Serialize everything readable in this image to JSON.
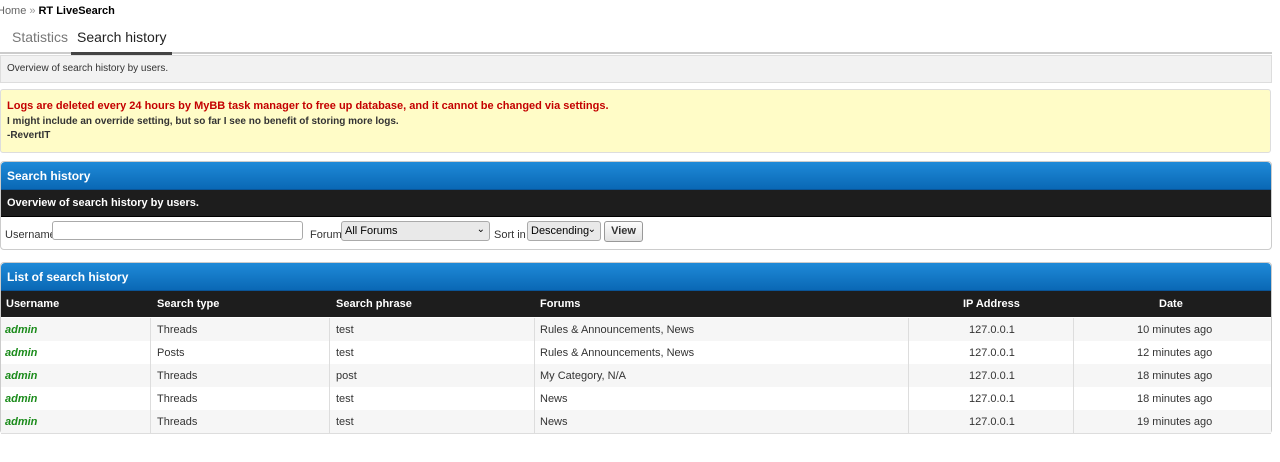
{
  "breadcrumb": {
    "home": "Home",
    "separator": "»",
    "current": "RT LiveSearch"
  },
  "tabs": [
    {
      "label": "Statistics"
    },
    {
      "label": "Search history"
    }
  ],
  "page_description": "Overview of search history by users.",
  "notice": {
    "warning": "Logs are deleted every 24 hours by MyBB task manager to free up database, and it cannot be changed via settings.",
    "line2": "I might include an override setting, but so far I see no benefit of storing more logs.",
    "signature": "-RevertIT"
  },
  "filter_box": {
    "title": "Search history",
    "subtitle": "Overview of search history by users.",
    "username_label": "Username",
    "username_value": "",
    "forum_label": "Forum",
    "forum_selected": "All Forums",
    "sort_label": "Sort in",
    "sort_selected": "Descending",
    "view_button": "View"
  },
  "history": {
    "title": "List of search history",
    "columns": [
      "Username",
      "Search type",
      "Search phrase",
      "Forums",
      "IP Address",
      "Date"
    ],
    "rows": [
      {
        "username": "admin",
        "type": "Threads",
        "phrase": "test",
        "forums": [
          "Rules & Announcements",
          "News"
        ],
        "ip": "127.0.0.1",
        "date": "10 minutes ago"
      },
      {
        "username": "admin",
        "type": "Posts",
        "phrase": "test",
        "forums": [
          "Rules & Announcements",
          "News"
        ],
        "ip": "127.0.0.1",
        "date": "12 minutes ago"
      },
      {
        "username": "admin",
        "type": "Threads",
        "phrase": "post",
        "forums": [
          "My Category",
          "N/A"
        ],
        "ip": "127.0.0.1",
        "date": "18 minutes ago"
      },
      {
        "username": "admin",
        "type": "Threads",
        "phrase": "test",
        "forums": [
          "News"
        ],
        "ip": "127.0.0.1",
        "date": "18 minutes ago"
      },
      {
        "username": "admin",
        "type": "Threads",
        "phrase": "test",
        "forums": [
          "News"
        ],
        "ip": "127.0.0.1",
        "date": "19 minutes ago"
      }
    ]
  },
  "colors": {
    "header_blue": "#0a68b5",
    "dark_bar": "#1d1d1d",
    "notice_bg": "#fffcc7",
    "warning_red": "#c40000",
    "username_green": "#1a8b1a",
    "link_blue": "#1f74b5"
  }
}
